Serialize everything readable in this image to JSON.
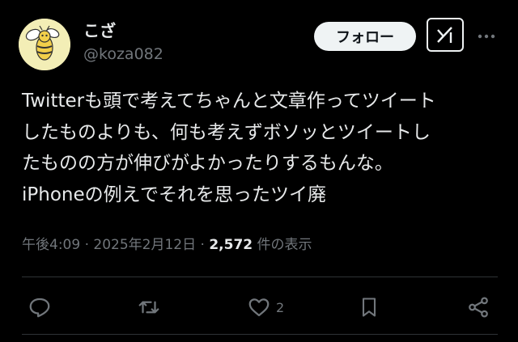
{
  "author": {
    "display_name": "こざ",
    "handle": "@koza082",
    "avatar_icon": "bee-icon"
  },
  "header": {
    "follow_label": "フォロー",
    "grok_icon": "grok-icon",
    "more_icon": "more-dots-icon"
  },
  "tweet": {
    "lines": [
      "Twitterも頭で考えてちゃんと文章作ってツイート",
      "したものよりも、何も考えずボソッとツイートし",
      "たものの方が伸びがよかったりするもんな。",
      "iPhoneの例えでそれを思ったツイ廃"
    ]
  },
  "meta": {
    "time": "午後4:09",
    "separator": "·",
    "date": "2025年2月12日",
    "views_count": "2,572",
    "views_label": "件の表示"
  },
  "actions": {
    "reply_icon": "reply-icon",
    "retweet_icon": "retweet-icon",
    "like_icon": "heart-icon",
    "like_count": "2",
    "bookmark_icon": "bookmark-icon",
    "share_icon": "share-icon"
  },
  "colors": {
    "background": "#000000",
    "text": "#e7e9ea",
    "secondary": "#71767b",
    "divider": "#2f3336",
    "button_bg": "#eff3f4"
  }
}
